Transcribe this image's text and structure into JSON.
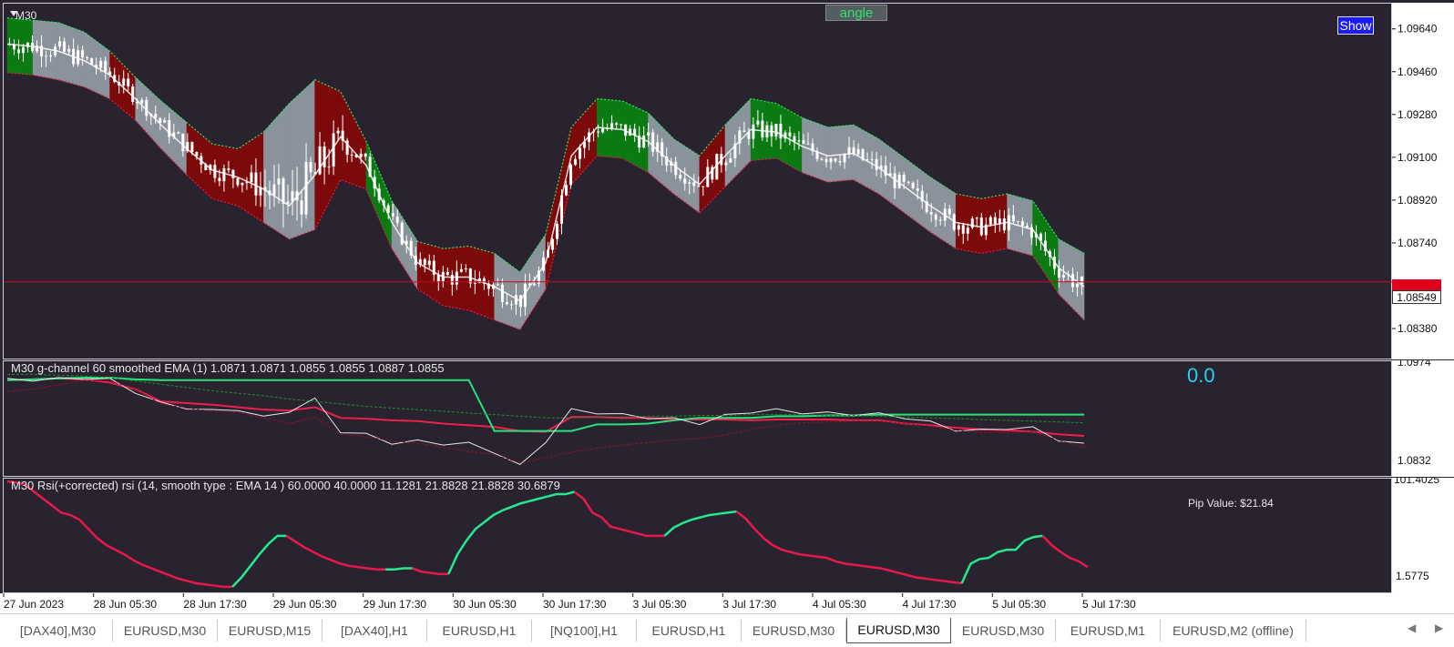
{
  "chart_data": [
    {
      "type": "line",
      "title": "",
      "caption": "",
      "timeframe_label": "M30",
      "ylim": [
        1.0825,
        1.0975
      ],
      "y_ticks": [
        "1.09640",
        "1.09460",
        "1.09280",
        "1.09100",
        "1.08920",
        "1.08740",
        "1.08549",
        "1.08380"
      ],
      "y_tick_values": [
        1.0964,
        1.0946,
        1.0928,
        1.091,
        1.0892,
        1.0874,
        1.0855,
        1.0838
      ],
      "current_price": 1.08549,
      "current_price_label": "1.08549",
      "horizontal_line_price": 1.0858,
      "x_labels": [
        "27 Jun 2023",
        "28 Jun 05:30",
        "28 Jun 17:30",
        "29 Jun 05:30",
        "29 Jun 17:30",
        "30 Jun 05:30",
        "30 Jun 17:30",
        "3 Jul 05:30",
        "3 Jul 17:30",
        "4 Jul 05:30",
        "4 Jul 17:30",
        "5 Jul 05:30",
        "5 Jul 17:30"
      ],
      "bar_count": 236,
      "series": [
        {
          "name": "upper_band",
          "values": [
            1.0969,
            1.0968,
            1.0967,
            1.0963,
            1.0955,
            1.0944,
            1.0934,
            1.0925,
            1.0916,
            1.0914,
            1.0921,
            1.0933,
            1.0943,
            1.0938,
            1.0917,
            1.0892,
            1.0875,
            1.0872,
            1.0873,
            1.087,
            1.0862,
            1.0878,
            1.0923,
            1.0935,
            1.0934,
            1.0929,
            1.0918,
            1.0911,
            1.0924,
            1.0935,
            1.0933,
            1.0927,
            1.0923,
            1.0924,
            1.0918,
            1.091,
            1.0902,
            1.0895,
            1.0893,
            1.0895,
            1.0892,
            1.0876,
            1.087
          ]
        },
        {
          "name": "lower_band",
          "values": [
            1.0946,
            1.0945,
            1.0943,
            1.094,
            1.0935,
            1.0926,
            1.0914,
            1.0903,
            1.0893,
            1.089,
            1.0883,
            1.0876,
            1.088,
            1.0901,
            1.0897,
            1.0872,
            1.0855,
            1.0848,
            1.0846,
            1.0842,
            1.0838,
            1.0855,
            1.0899,
            1.0911,
            1.091,
            1.0904,
            1.0895,
            1.0887,
            1.0898,
            1.0909,
            1.091,
            1.0904,
            1.09,
            1.0901,
            1.0895,
            1.0887,
            1.0879,
            1.0872,
            1.087,
            1.0872,
            1.0869,
            1.0853,
            1.0842
          ]
        },
        {
          "name": "mid_ema",
          "values": [
            1.0958,
            1.0957,
            1.0955,
            1.0951,
            1.0945,
            1.0935,
            1.0924,
            1.0914,
            1.0905,
            1.0902,
            1.0897,
            1.089,
            1.0903,
            1.0919,
            1.0907,
            1.0883,
            1.0866,
            1.086,
            1.086,
            1.0856,
            1.085,
            1.0866,
            1.0911,
            1.0923,
            1.0922,
            1.0917,
            1.0907,
            1.0899,
            1.0911,
            1.0922,
            1.0921,
            1.0915,
            1.0911,
            1.0912,
            1.0906,
            1.0898,
            1.089,
            1.0883,
            1.0881,
            1.0883,
            1.088,
            1.0864,
            1.0856
          ]
        }
      ],
      "regimes": [
        "green",
        "gray",
        "gray",
        "gray",
        "red",
        "gray",
        "gray",
        "red",
        "red",
        "red",
        "gray",
        "gray",
        "red",
        "red",
        "green",
        "gray",
        "red",
        "red",
        "red",
        "gray",
        "gray",
        "red",
        "red",
        "green",
        "green",
        "gray",
        "gray",
        "red",
        "gray",
        "green",
        "green",
        "gray",
        "gray",
        "gray",
        "gray",
        "gray",
        "gray",
        "red",
        "red",
        "gray",
        "green",
        "gray",
        "red"
      ],
      "regime_colors": {
        "green": "#0c7a12",
        "red": "#7d0a0a",
        "gray": "#8a929b"
      },
      "candle_color": "#ffffff",
      "indicator_line_color": "#ffffff"
    },
    {
      "type": "line",
      "caption": "M30 g-channel  60 smoothed EMA (1) 1.0871 1.0871 1.0855 1.0855 1.0887 1.0855",
      "value_label": "0.0",
      "ylim": [
        1.0832,
        1.0974
      ],
      "y_ticks": [
        "1.0974",
        "1.0832"
      ],
      "series": [
        {
          "name": "",
          "color": "#f01f4a",
          "values": [
            1.0951,
            1.0952,
            1.0953,
            1.0952,
            1.0948,
            1.094,
            1.0925,
            1.0923,
            1.0921,
            1.0918,
            1.0915,
            1.0914,
            1.0918,
            1.0905,
            1.0904,
            1.0902,
            1.0901,
            1.0898,
            1.0896,
            1.0894,
            1.0889,
            1.0888,
            1.0906,
            1.0906,
            1.0905,
            1.0905,
            1.0903,
            1.0903,
            1.0903,
            1.0902,
            1.0903,
            1.0903,
            1.0903,
            1.0902,
            1.0902,
            1.0898,
            1.0896,
            1.0893,
            1.0891,
            1.089,
            1.0888,
            1.0885,
            1.0883
          ]
        },
        {
          "name": "",
          "color": "#28e37c",
          "values": [
            1.0951,
            1.0952,
            1.0953,
            1.0954,
            1.0954,
            1.0952,
            1.0951,
            1.0951,
            1.0951,
            1.0951,
            1.0951,
            1.0951,
            1.0951,
            1.0951,
            1.0951,
            1.0951,
            1.0951,
            1.0951,
            1.0951,
            1.0889,
            1.0889,
            1.0889,
            1.0889,
            1.0897,
            1.0897,
            1.0898,
            1.0902,
            1.0905,
            1.0905,
            1.0905,
            1.0907,
            1.0907,
            1.0908,
            1.0908,
            1.0909,
            1.0909,
            1.0909,
            1.0909,
            1.0909,
            1.0909,
            1.0909,
            1.0909,
            1.0909
          ]
        },
        {
          "name": "",
          "color": "#e8e8e8",
          "values": [
            1.0951,
            1.0952,
            1.0952,
            1.0954,
            1.0951,
            1.0937,
            1.0922,
            1.0918,
            1.0913,
            1.0916,
            1.0905,
            1.0914,
            1.0927,
            1.0889,
            1.0884,
            1.0875,
            1.0876,
            1.0874,
            1.0873,
            1.0864,
            1.0846,
            1.0877,
            1.0914,
            1.0912,
            1.0908,
            1.0906,
            1.0903,
            1.0899,
            1.0907,
            1.0913,
            1.0914,
            1.0912,
            1.091,
            1.091,
            1.0909,
            1.0906,
            1.0899,
            1.0891,
            1.0889,
            1.0893,
            1.0892,
            1.0879,
            1.0872
          ]
        },
        {
          "name": "",
          "color": "#9a0e2a",
          "values": [
            1.0937,
            1.094,
            1.0945,
            1.0951,
            1.095,
            1.094,
            1.0922,
            1.0917,
            1.0913,
            1.0912,
            1.0905,
            1.0898,
            1.0906,
            1.0885,
            1.0882,
            1.0877,
            1.0874,
            1.0869,
            1.0864,
            1.086,
            1.085,
            1.0856,
            1.0863,
            1.0868,
            1.0872,
            1.0875,
            1.0878,
            1.088,
            1.0884,
            1.0891,
            1.0896,
            1.0899,
            1.09,
            1.0901,
            1.0901,
            1.0898,
            1.0895,
            1.089,
            1.0887,
            1.0887,
            1.0888,
            1.0878,
            1.0869
          ]
        },
        {
          "name": "",
          "color": "#1f8f2a",
          "dashed": true,
          "values": [
            1.0958,
            1.0958,
            1.0957,
            1.0956,
            1.0954,
            1.095,
            1.0946,
            1.0942,
            1.0938,
            1.0935,
            1.0932,
            1.0928,
            1.0925,
            1.0922,
            1.0919,
            1.0917,
            1.0915,
            1.0913,
            1.0911,
            1.0909,
            1.0907,
            1.0905,
            1.0905,
            1.0906,
            1.0906,
            1.0907,
            1.0907,
            1.0908,
            1.0908,
            1.0909,
            1.0909,
            1.0909,
            1.0908,
            1.0908,
            1.0907,
            1.0906,
            1.0905,
            1.0904,
            1.0903,
            1.0902,
            1.0901,
            1.09,
            1.0899
          ]
        }
      ]
    },
    {
      "type": "line",
      "caption": "M30 Rsi(+corrected) rsi (14, smooth type : EMA  14 ) 60.0000 40.0000 11.1281 21.8828 21.8828 30.6879",
      "pip_value_label": "Pip Value: $21.84",
      "ylim": [
        1.5775,
        101.4025
      ],
      "y_ticks": [
        "101.4025",
        "1.5775"
      ],
      "segments": [
        {
          "trend": "down",
          "values": [
            99,
            98,
            96,
            90,
            84,
            78,
            72,
            70,
            66,
            58,
            50,
            44,
            40,
            36,
            31,
            27,
            24,
            21,
            18,
            15,
            13,
            11,
            10,
            9,
            8,
            8
          ]
        },
        {
          "trend": "up",
          "values": [
            8,
            16,
            26,
            36,
            45,
            52,
            52
          ]
        },
        {
          "trend": "down",
          "values": [
            52,
            47,
            42,
            38,
            34,
            31,
            28,
            26,
            25,
            24,
            23,
            23
          ]
        },
        {
          "trend": "up",
          "values": [
            23,
            23,
            24,
            24
          ]
        },
        {
          "trend": "down",
          "values": [
            24,
            21,
            20,
            19,
            19
          ]
        },
        {
          "trend": "up",
          "values": [
            19,
            36,
            48,
            58,
            64,
            70,
            74,
            77,
            80,
            82,
            84,
            86,
            88,
            88,
            90
          ]
        },
        {
          "trend": "down",
          "values": [
            90,
            84,
            72,
            68,
            60,
            58,
            56,
            54,
            52,
            52,
            52
          ]
        },
        {
          "trend": "up",
          "values": [
            52,
            59,
            63,
            66,
            68,
            70,
            71,
            72,
            73
          ]
        },
        {
          "trend": "down",
          "values": [
            73,
            67,
            58,
            50,
            44,
            40,
            38,
            36,
            35,
            34,
            33,
            30,
            28,
            27,
            26,
            25,
            24,
            22,
            20,
            18,
            16,
            15,
            14,
            13,
            12,
            11
          ]
        },
        {
          "trend": "up",
          "values": [
            11,
            28,
            32,
            33,
            38,
            40,
            40,
            48,
            51,
            52
          ]
        },
        {
          "trend": "down",
          "values": [
            52,
            44,
            38,
            33,
            30,
            25
          ]
        }
      ],
      "colors": {
        "up": "#23ea8c",
        "down": "#e8194a"
      }
    }
  ],
  "buttons": {
    "angle": "angle",
    "show": "Show"
  },
  "tabs": [
    "[DAX40],M30",
    "EURUSD,M30",
    "EURUSD,M15",
    "[DAX40],H1",
    "EURUSD,H1",
    "[NQ100],H1",
    "EURUSD,H1",
    "EURUSD,M30",
    "EURUSD,M30",
    "EURUSD,M30",
    "EURUSD,M1",
    "EURUSD,M2 (offline)"
  ],
  "active_tab_index": 8,
  "scroll_left": "◀",
  "scroll_right": "▶"
}
